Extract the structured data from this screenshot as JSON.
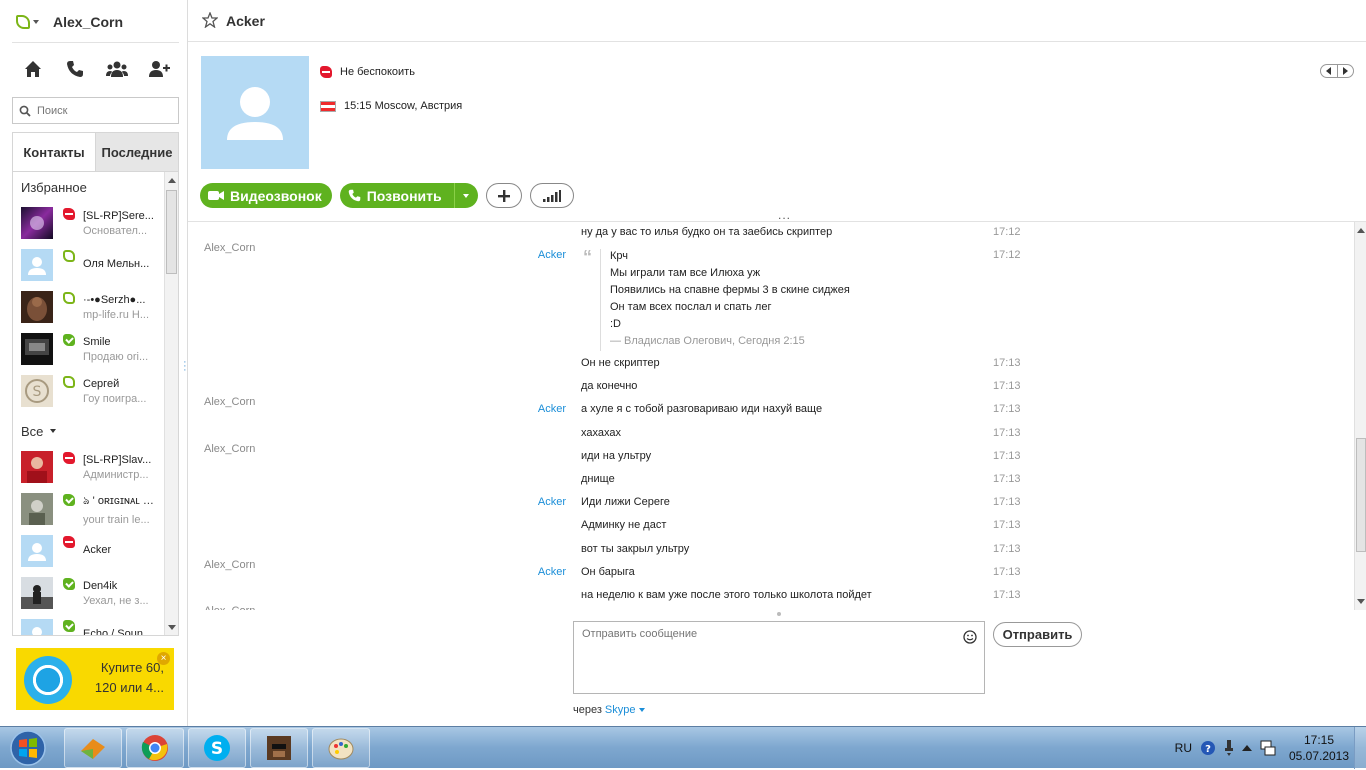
{
  "sidebar": {
    "user_name": "Alex_Corn",
    "search_placeholder": "Поиск",
    "tabs": {
      "contacts": "Контакты",
      "recent": "Последние"
    },
    "favorites_title": "Избранное",
    "all_title": "Все",
    "favorites": [
      {
        "name": "[SL-RP]Serе...",
        "mood": "Основател...",
        "status": "dnd"
      },
      {
        "name": "Оля Мельн...",
        "mood": "",
        "status": "offline"
      },
      {
        "name": "·-•●Serzh●...",
        "mood": "mp-life.ru Н...",
        "status": "offline"
      },
      {
        "name": "Smile",
        "mood": "Продаю ori...",
        "status": "online"
      },
      {
        "name": "Сергей",
        "mood": "Гоу поигра...",
        "status": "offline"
      }
    ],
    "all": [
      {
        "name": "[SL-RP]Slav...",
        "mood": "Администр...",
        "status": "dnd"
      },
      {
        "name": "ঌ ' ᴏʀɪɢɪɴᴀʟ ' ...",
        "mood": "your train le...",
        "status": "online"
      },
      {
        "name": "Acker",
        "mood": "",
        "status": "dnd"
      },
      {
        "name": "Den4ik",
        "mood": "Уехал, не з...",
        "status": "online"
      },
      {
        "name": "Echo / Soun...",
        "mood": "",
        "status": "online"
      }
    ],
    "promo": {
      "text": "Купите 60, 120 или 4..."
    }
  },
  "header": {
    "title": "Acker",
    "status_text": "Не беспокоить",
    "location_text": "15:15 Moscow, Австрия"
  },
  "actions": {
    "video_call": "Видеозвонок",
    "call": "Позвонить"
  },
  "messages": [
    {
      "author": "Alex_Corn",
      "side": "me",
      "text": "ну да у вас то илья будко он та заебись скриптер",
      "time": "17:12"
    },
    {
      "author": "Acker",
      "side": "them",
      "text": "",
      "time": "17:12",
      "quote": {
        "lines": [
          "Крч",
          "Мы играли там все Илюха уж",
          "Появились на спавне фермы 3 в скине сиджея",
          "Он там всех послал и спать лег",
          ":D"
        ],
        "meta": "— Владислав Олегович, Сегодня 2:15"
      }
    },
    {
      "author": "",
      "side": "them",
      "text": "Он не скриптер",
      "time": "17:13"
    },
    {
      "author": "Alex_Corn",
      "side": "me",
      "text": "да конечно",
      "time": "17:13"
    },
    {
      "author": "Acker",
      "side": "them",
      "text": "а хуле я с тобой разговариваю иди нахуй ваще",
      "time": "17:13"
    },
    {
      "author": "Alex_Corn",
      "side": "me",
      "text": "хахахах",
      "time": "17:13"
    },
    {
      "author": "",
      "side": "me",
      "text": "иди на ультру",
      "time": "17:13"
    },
    {
      "author": "",
      "side": "me",
      "text": "днище",
      "time": "17:13"
    },
    {
      "author": "Acker",
      "side": "them",
      "text": "Иди лижи Сереге",
      "time": "17:13"
    },
    {
      "author": "",
      "side": "them",
      "text": "Админку не даст",
      "time": "17:13"
    },
    {
      "author": "Alex_Corn",
      "side": "me",
      "text": "вот ты закрыл ультру",
      "time": "17:13"
    },
    {
      "author": "Acker",
      "side": "them",
      "text": "Он барыга",
      "time": "17:13"
    },
    {
      "author": "Alex_Corn",
      "side": "me",
      "text": "на неделю к вам уже после этого только школота пойдет",
      "time": "17:13"
    }
  ],
  "compose": {
    "placeholder": "Отправить сообщение",
    "send_label": "Отправить",
    "via_label": "через",
    "via_link": "Skype"
  },
  "taskbar": {
    "lang": "RU",
    "time": "17:15",
    "date": "05.07.2013"
  },
  "colors": {
    "skype_green": "#5fb21f",
    "link_blue": "#1b8ed8",
    "dnd_red": "#e3182d",
    "promo_yellow": "#f9d900"
  }
}
